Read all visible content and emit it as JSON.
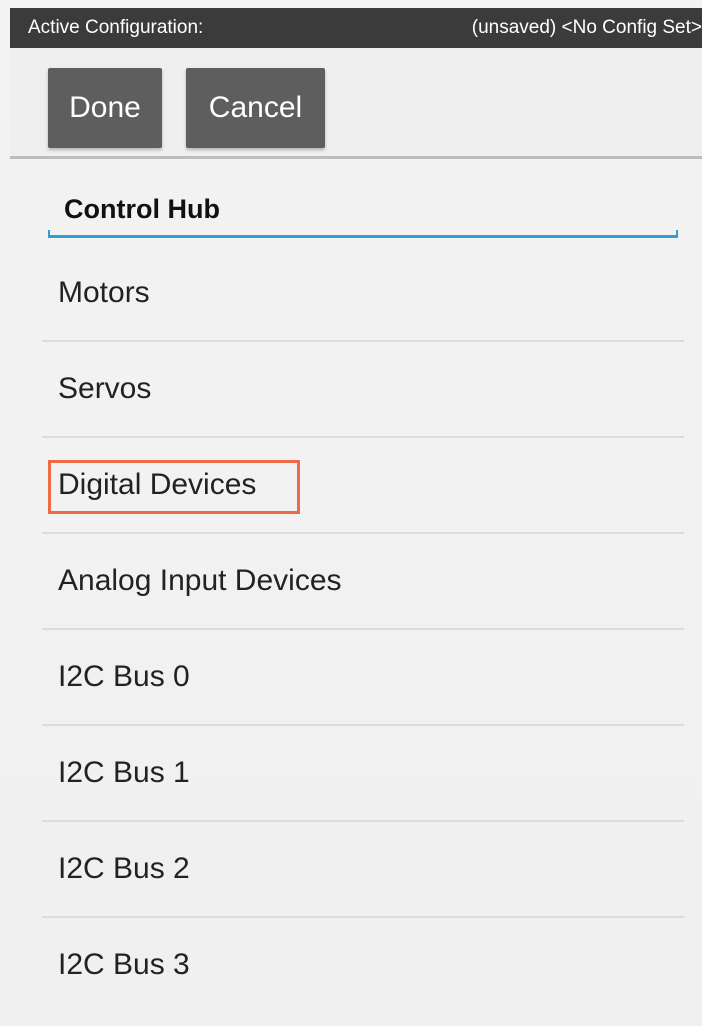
{
  "status_bar": {
    "label": "Active Configuration:",
    "value": "(unsaved) <No Config Set>"
  },
  "toolbar": {
    "done_label": "Done",
    "cancel_label": "Cancel"
  },
  "hub": {
    "name": "Control Hub"
  },
  "menu": {
    "items": [
      {
        "label": "Motors"
      },
      {
        "label": "Servos"
      },
      {
        "label": "Digital Devices"
      },
      {
        "label": "Analog Input Devices"
      },
      {
        "label": "I2C Bus 0"
      },
      {
        "label": "I2C Bus 1"
      },
      {
        "label": "I2C Bus 2"
      },
      {
        "label": "I2C Bus 3"
      }
    ],
    "highlighted_item": "Digital Devices"
  },
  "colors": {
    "status_bar_bg": "#3b3b3b",
    "button_bg": "#5e5e5e",
    "accent_underline": "#2f9fd4",
    "highlight_border": "#ef6a45"
  }
}
